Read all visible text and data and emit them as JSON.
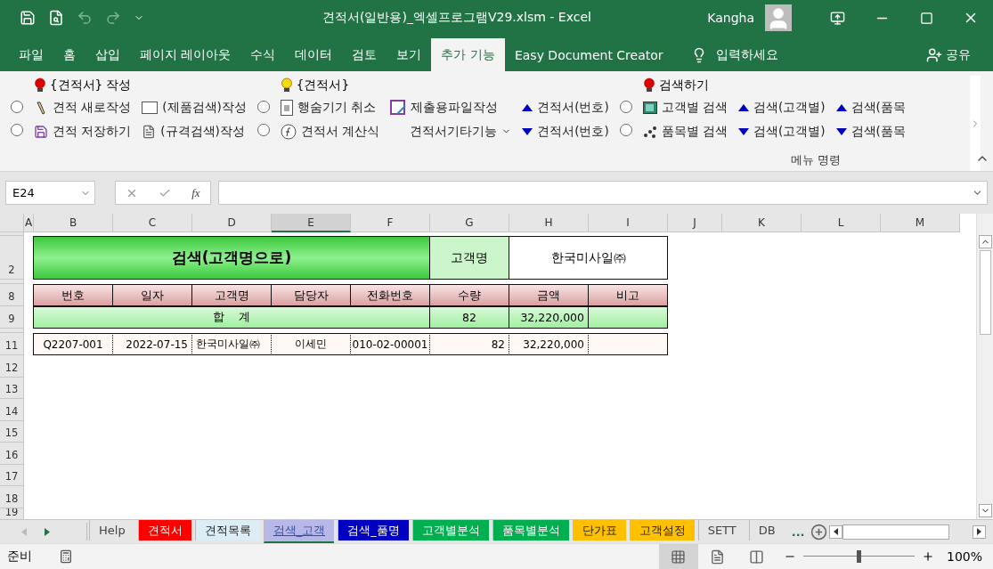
{
  "title_bar": {
    "title": "견적서(일반용)_엑셀프로그램V29.xlsm - Excel",
    "user": "Kangha"
  },
  "ribbon_tabs": [
    {
      "label": "파일",
      "selected": false
    },
    {
      "label": "홈",
      "selected": false
    },
    {
      "label": "삽입",
      "selected": false
    },
    {
      "label": "페이지 레이아웃",
      "selected": false
    },
    {
      "label": "수식",
      "selected": false
    },
    {
      "label": "데이터",
      "selected": false
    },
    {
      "label": "검토",
      "selected": false
    },
    {
      "label": "보기",
      "selected": false
    },
    {
      "label": "추가 기능",
      "selected": true
    },
    {
      "label": "Easy Document Creator",
      "selected": false
    }
  ],
  "tell_me": "입력하세요",
  "share": "공유",
  "ribbon": {
    "sections": [
      {
        "header": "{견적서} 작성",
        "color": "#e00000",
        "columns": [
          [
            {
              "kind": "radio",
              "selected": false
            },
            {
              "kind": "radio",
              "selected": false
            }
          ],
          [
            {
              "kind": "pencil",
              "label": "견적 새로작성"
            },
            {
              "kind": "save",
              "label": "견적 저장하기"
            }
          ],
          [
            {
              "kind": "blank",
              "label": "(제품검색)작성"
            },
            {
              "kind": "page",
              "label": "(규격검색)작성"
            }
          ]
        ]
      },
      {
        "header": "{견적서}",
        "color": "#f0e000",
        "columns": [
          [
            {
              "kind": "radio",
              "selected": false
            },
            {
              "kind": "radio",
              "selected": false
            }
          ],
          [
            {
              "kind": "split",
              "label": "행숨기기 취소"
            },
            {
              "kind": "fx",
              "label": "견적서 계산식"
            }
          ],
          [
            {
              "kind": "export",
              "label": "제출용파일작성"
            },
            {
              "kind": "dropdown",
              "label": "견적서기타기능"
            }
          ],
          [
            {
              "kind": "up",
              "label": "견적서(번호)"
            },
            {
              "kind": "down",
              "label": "견적서(번호)"
            }
          ]
        ]
      },
      {
        "header": "검색하기",
        "color": "#e00000",
        "columns": [
          [
            {
              "kind": "radio",
              "selected": false
            },
            {
              "kind": "radio",
              "selected": false
            }
          ],
          [
            {
              "kind": "film",
              "label": "고객별 검색"
            },
            {
              "kind": "scatter",
              "label": "품목별 검색"
            }
          ],
          [
            {
              "kind": "up",
              "label": "검색(고객별)"
            },
            {
              "kind": "down",
              "label": "검색(고객별)"
            }
          ],
          [
            {
              "kind": "up",
              "label": "검색(품목"
            },
            {
              "kind": "down",
              "label": "검색(품목"
            }
          ]
        ]
      }
    ],
    "group_label": "메뉴 명령"
  },
  "name_box": "E24",
  "column_headers": [
    {
      "label": "A",
      "selected": false
    },
    {
      "label": "B",
      "selected": false
    },
    {
      "label": "C",
      "selected": false
    },
    {
      "label": "D",
      "selected": false
    },
    {
      "label": "E",
      "selected": true
    },
    {
      "label": "F",
      "selected": false
    },
    {
      "label": "G",
      "selected": false
    },
    {
      "label": "H",
      "selected": false
    },
    {
      "label": "I",
      "selected": false
    },
    {
      "label": "J",
      "selected": false
    },
    {
      "label": "K",
      "selected": false
    },
    {
      "label": "L",
      "selected": false
    },
    {
      "label": "M",
      "selected": false
    }
  ],
  "sheet": {
    "title": "검색(고객명으로)",
    "customer_label": "고객명",
    "customer_value": "한국미사일㈜",
    "header_row": {
      "row": "8",
      "cells": [
        "번호",
        "일자",
        "고객명",
        "담당자",
        "전화번호",
        "수량",
        "금액",
        "비고"
      ]
    },
    "total_row": {
      "row": "9",
      "label": "합    계",
      "quantity": "82",
      "amount": "32,220,000"
    },
    "title_row": "2",
    "rows": [
      {
        "row": "11",
        "cells": [
          "Q2207-001",
          "2022-07-15",
          "한국미사일㈜",
          "이세민",
          "010-02-00001",
          "82",
          "32,220,000",
          ""
        ]
      }
    ],
    "empty_rows": [
      "12",
      "13",
      "14",
      "15",
      "16",
      "17",
      "18",
      "19"
    ]
  },
  "sheet_tabs": [
    {
      "label": "Help",
      "selected": false
    },
    {
      "label": "견적서",
      "color": "#ff0000",
      "selected": false
    },
    {
      "label": "견적목록",
      "color": "#dcedf5",
      "selected": false
    },
    {
      "label": "검색_고객",
      "color": "#b8b8e8",
      "selected": true
    },
    {
      "label": "검색_품명",
      "color": "#0000c0",
      "selected": false
    },
    {
      "label": "고객별분석",
      "color": "#00b050",
      "selected": false
    },
    {
      "label": "품목별분석",
      "color": "#00b050",
      "selected": false
    },
    {
      "label": "단가표",
      "color": "#ffc000",
      "selected": false
    },
    {
      "label": "고객설정",
      "color": "#ffc000",
      "selected": false
    },
    {
      "label": "SETT",
      "selected": false
    },
    {
      "label": "DB",
      "selected": false
    }
  ],
  "more_tabs": "...",
  "status_bar": {
    "status": "준비",
    "zoom": "100%",
    "zoom_level": {
      "level": 0.5
    }
  }
}
